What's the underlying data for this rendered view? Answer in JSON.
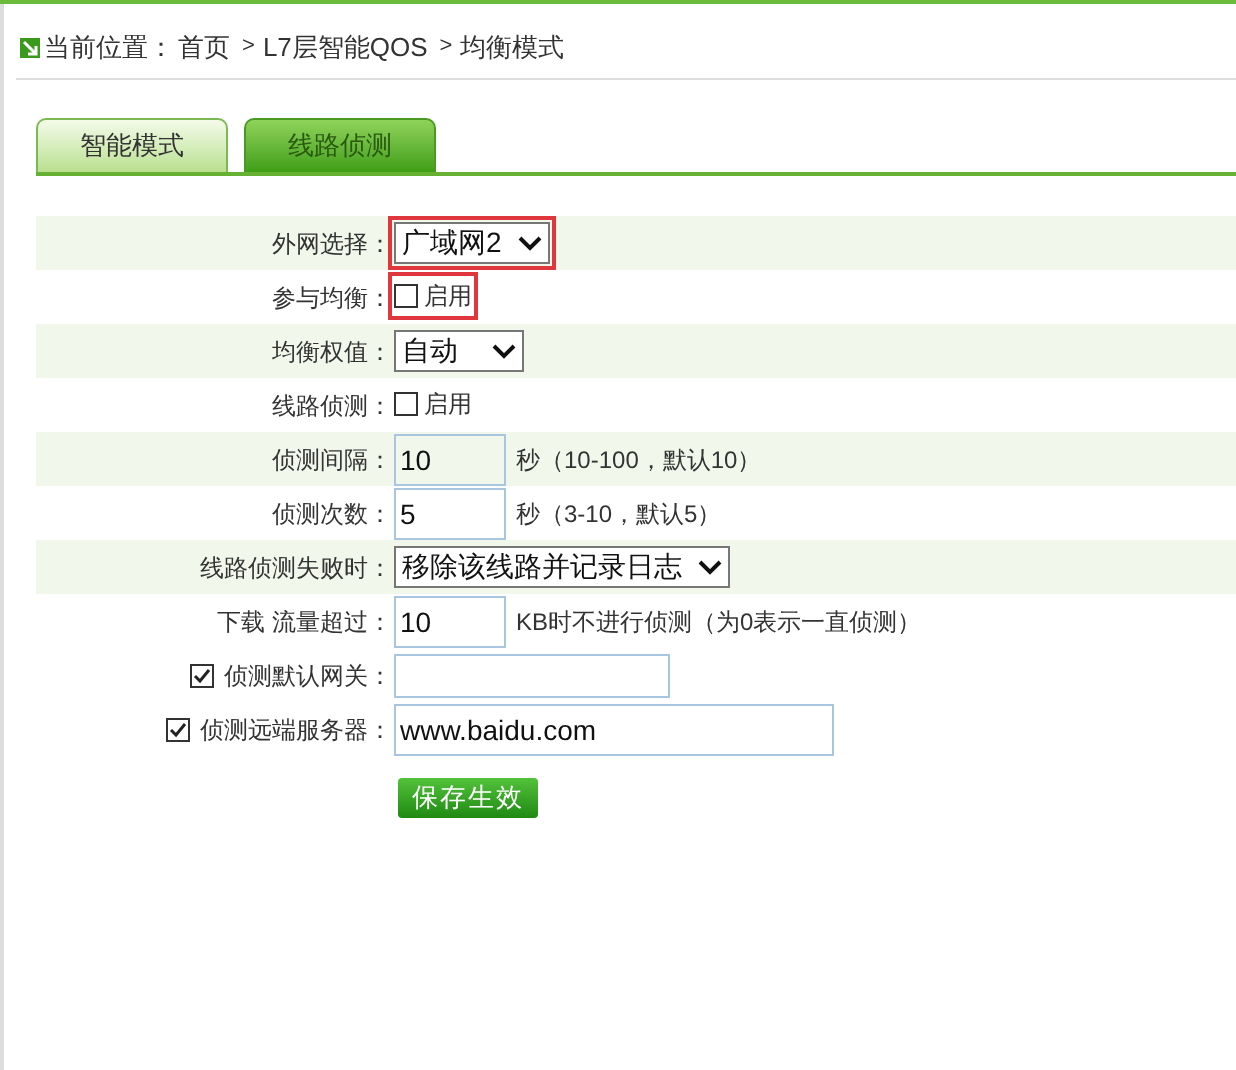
{
  "breadcrumb": {
    "prefix": "当前位置：",
    "items": [
      {
        "label": "首页"
      },
      {
        "label": "L7层智能QOS"
      },
      {
        "label": "均衡模式"
      }
    ],
    "separator": ">"
  },
  "tabs": [
    {
      "label": "智能模式",
      "selected": false
    },
    {
      "label": "线路侦测",
      "selected": true
    }
  ],
  "rows": [
    {
      "kind": "select",
      "label": "外网选择：",
      "value": "广域网2",
      "shaded": true,
      "highlighted": true
    },
    {
      "kind": "checkbox",
      "label": "参与均衡：",
      "option": "启用",
      "checked": false,
      "shaded": false,
      "highlighted": true
    },
    {
      "kind": "select",
      "label": "均衡权值：",
      "value": "自动",
      "shaded": true,
      "highlighted": false
    },
    {
      "kind": "checkbox",
      "label": "线路侦测：",
      "option": "启用",
      "checked": false,
      "shaded": false,
      "highlighted": false
    },
    {
      "kind": "input",
      "label": "侦测间隔：",
      "value": "10",
      "note": "秒（10-100，默认10）",
      "shaded": true,
      "highlighted": false
    },
    {
      "kind": "input",
      "label": "侦测次数：",
      "value": "5",
      "note": "秒（3-10，默认5）",
      "shaded": false,
      "highlighted": false
    },
    {
      "kind": "select",
      "label": "线路侦测失败时：",
      "value": "移除该线路并记录日志",
      "shaded": true,
      "highlighted": false
    },
    {
      "kind": "input",
      "label": "下载 流量超过：",
      "value": "10",
      "note": "KB时不进行侦测（为0表示一直侦测）",
      "shaded": false,
      "highlighted": false
    },
    {
      "kind": "checked-input",
      "label": "侦测默认网关：",
      "checked": true,
      "value": "",
      "shaded": false,
      "highlighted": false
    },
    {
      "kind": "checked-input",
      "label": "侦测远端服务器：",
      "checked": true,
      "value": "www.baidu.com",
      "shaded": false,
      "highlighted": false
    }
  ],
  "save_button": "保存生效"
}
